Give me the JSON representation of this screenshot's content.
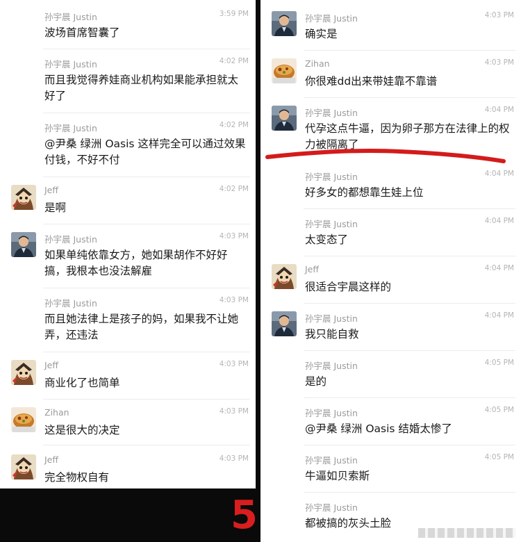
{
  "page_number": "5",
  "accent_colors": {
    "underline": "#d41b1b",
    "page_number": "#d81e1e",
    "background": "#0a0a0a"
  },
  "left": {
    "messages": [
      {
        "sender": "孙宇晨 Justin",
        "time": "3:59 PM",
        "avatar": "",
        "text": "波场首席智囊了"
      },
      {
        "sender": "孙宇晨 Justin",
        "time": "4:02 PM",
        "avatar": "",
        "text": "而且我觉得养娃商业机构如果能承担就太好了"
      },
      {
        "sender": "孙宇晨 Justin",
        "time": "4:02 PM",
        "avatar": "",
        "text": "@尹桑 绿洲 Oasis 这样完全可以通过效果付钱，不好不付"
      },
      {
        "sender": "Jeff",
        "time": "4:02 PM",
        "avatar": "cartoon-avatar-icon",
        "text": "是啊"
      },
      {
        "sender": "孙宇晨 Justin",
        "time": "4:03 PM",
        "avatar": "person-avatar-icon",
        "text": "如果单纯依靠女方，她如果胡作不好好搞，我根本也没法解雇"
      },
      {
        "sender": "孙宇晨 Justin",
        "time": "4:03 PM",
        "avatar": "",
        "text": "而且她法律上是孩子的妈，如果我不让她弄，还违法"
      },
      {
        "sender": "Jeff",
        "time": "4:03 PM",
        "avatar": "cartoon-avatar-icon",
        "text": "商业化了也简单"
      },
      {
        "sender": "Zihan",
        "time": "4:03 PM",
        "avatar": "food-avatar-icon",
        "text": "这是很大的决定"
      },
      {
        "sender": "Jeff",
        "time": "4:03 PM",
        "avatar": "cartoon-avatar-icon",
        "text": "完全物权自有"
      }
    ]
  },
  "right": {
    "messages": [
      {
        "sender": "孙宇晨 Justin",
        "time": "4:03 PM",
        "avatar": "person-avatar-icon",
        "text": "确实是"
      },
      {
        "sender": "Zihan",
        "time": "4:03 PM",
        "avatar": "food-avatar-icon",
        "text": "你很难dd出来带娃靠不靠谱"
      },
      {
        "sender": "孙宇晨 Justin",
        "time": "4:04 PM",
        "avatar": "person-avatar-icon",
        "text": "代孕这点牛逼，因为卵子那方在法律上的权力被隔离了"
      },
      {
        "sender": "孙宇晨 Justin",
        "time": "4:04 PM",
        "avatar": "",
        "text": "好多女的都想靠生娃上位"
      },
      {
        "sender": "孙宇晨 Justin",
        "time": "4:04 PM",
        "avatar": "",
        "text": "太变态了"
      },
      {
        "sender": "Jeff",
        "time": "4:04 PM",
        "avatar": "cartoon-avatar-icon",
        "text": "很适合宇晨这样的"
      },
      {
        "sender": "孙宇晨 Justin",
        "time": "4:04 PM",
        "avatar": "person-avatar-icon",
        "text": "我只能自救"
      },
      {
        "sender": "孙宇晨 Justin",
        "time": "4:05 PM",
        "avatar": "",
        "text": "是的"
      },
      {
        "sender": "孙宇晨 Justin",
        "time": "4:05 PM",
        "avatar": "",
        "text": "@尹桑 绿洲 Oasis 结婚太惨了"
      },
      {
        "sender": "孙宇晨 Justin",
        "time": "4:05 PM",
        "avatar": "",
        "text": "牛逼如贝索斯"
      },
      {
        "sender": "孙宇晨 Justin",
        "time": "",
        "avatar": "",
        "text": "都被搞的灰头土脸"
      }
    ]
  }
}
